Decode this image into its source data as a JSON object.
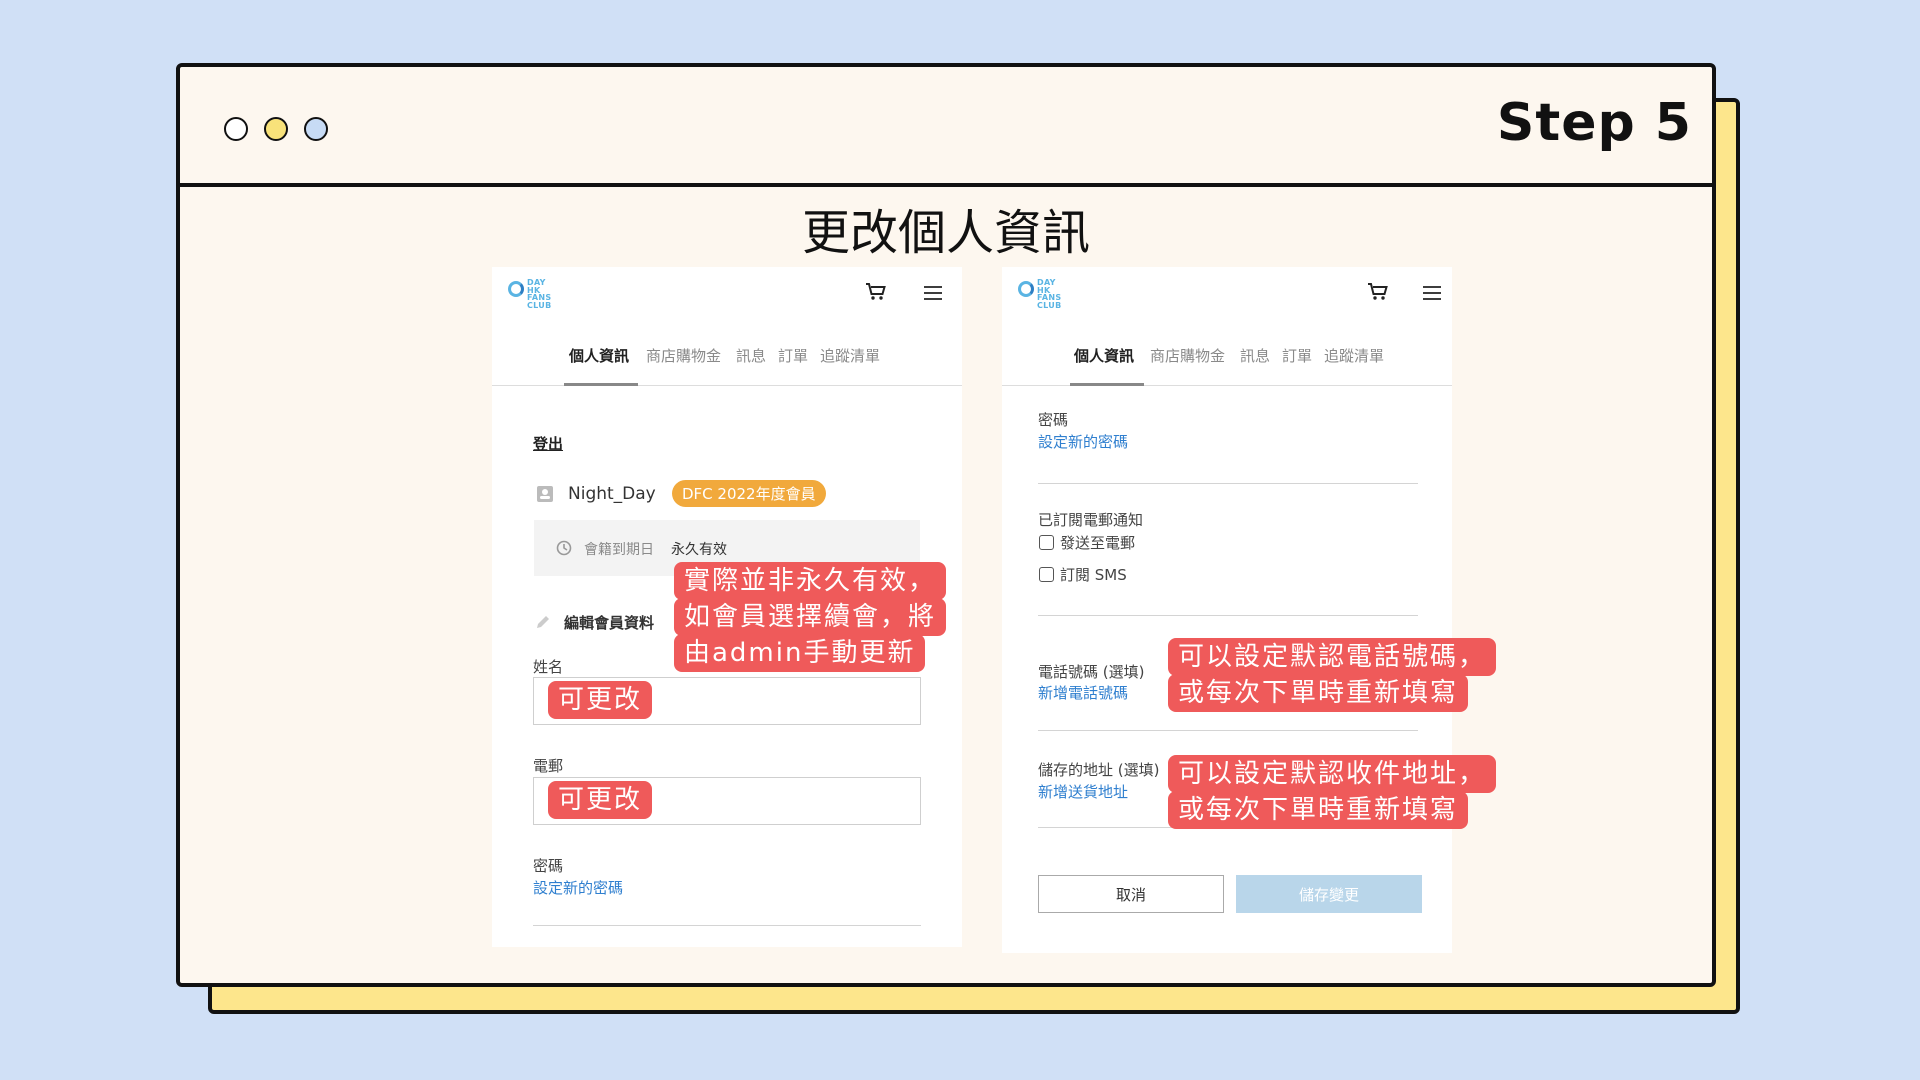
{
  "window": {
    "step_label": "Step 5",
    "heading": "更改個人資訊",
    "dot_colors": [
      "#ffffff",
      "#f8e27a",
      "#c7dbf5"
    ]
  },
  "logo": {
    "lines": [
      "DAY",
      "HK",
      "FANS",
      "CLUB"
    ]
  },
  "tabs": [
    "個人資訊",
    "商店購物金",
    "訊息",
    "訂單",
    "追蹤清單"
  ],
  "left": {
    "logout": "登出",
    "username": "Night_Day",
    "badge": "DFC 2022年度會員",
    "expiry_label": "會籍到期日",
    "expiry_value": "永久有效",
    "edit_title": "編輯會員資料",
    "name_label": "姓名",
    "email_label": "電郵",
    "password_label": "密碼",
    "password_link": "設定新的密碼",
    "callouts": {
      "expiry_note": [
        "實際並非永久有效，",
        "如會員選擇續會，將",
        "由admin手動更新"
      ],
      "name_note": "可更改",
      "email_note": "可更改"
    }
  },
  "right": {
    "password_label": "密碼",
    "password_link": "設定新的密碼",
    "subscribe_title": "已訂閱電郵通知",
    "subscribe_email": "發送至電郵",
    "subscribe_sms": "訂閱 SMS",
    "phone_label": "電話號碼 (選填)",
    "phone_link": "新增電話號碼",
    "address_label": "儲存的地址 (選填)",
    "address_link": "新增送貨地址",
    "cancel": "取消",
    "save": "儲存變更",
    "callouts": {
      "phone_note": [
        "可以設定默認電話號碼，",
        "或每次下單時重新填寫"
      ],
      "address_note": [
        "可以設定默認收件地址，",
        "或每次下單時重新填寫"
      ]
    }
  },
  "colors": {
    "accent_link": "#2f7fcf",
    "callout_red": "#ef5a5a",
    "badge_orange": "#f1a93c",
    "save_disabled": "#b9d6ea"
  }
}
